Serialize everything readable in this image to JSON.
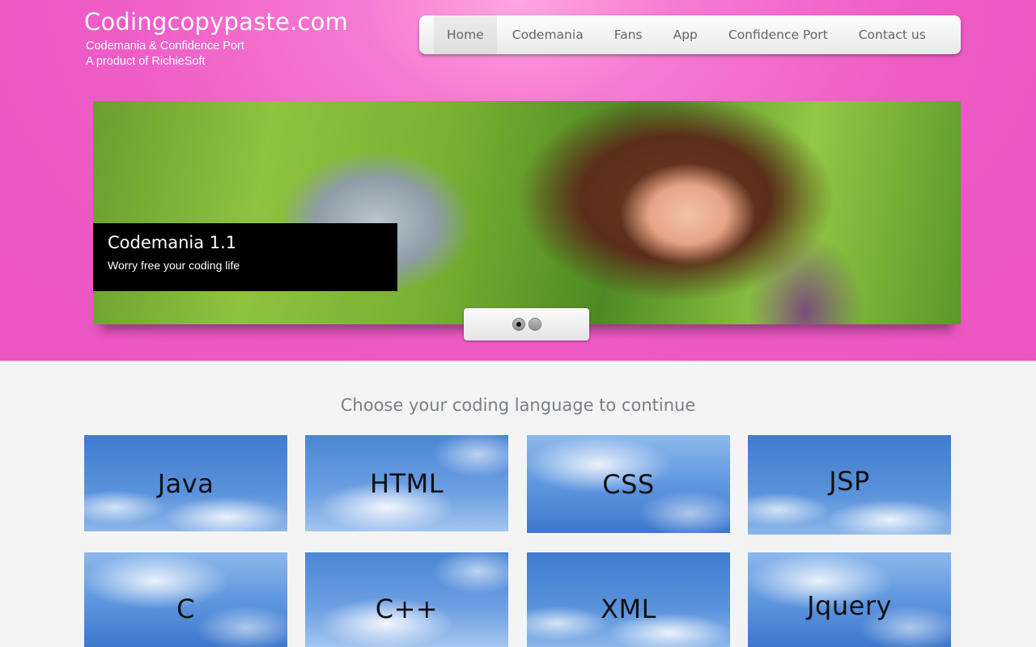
{
  "brand": {
    "title": "Codingcopypaste.com",
    "subtitle_line1": "Codemania & Confidence Port",
    "subtitle_line2": "A product of RichieSoft"
  },
  "nav": {
    "items": [
      {
        "label": "Home",
        "active": true
      },
      {
        "label": "Codemania",
        "active": false
      },
      {
        "label": "Fans",
        "active": false
      },
      {
        "label": "App",
        "active": false
      },
      {
        "label": "Confidence Port",
        "active": false
      },
      {
        "label": "Contact us",
        "active": false
      }
    ]
  },
  "slider": {
    "caption_title": "Codemania 1.1",
    "caption_text": "Worry free your coding life",
    "slide_count": 2,
    "active_slide": 1
  },
  "main": {
    "section_title": "Choose your coding language to continue",
    "tiles": [
      {
        "label": "Java"
      },
      {
        "label": "HTML"
      },
      {
        "label": "CSS"
      },
      {
        "label": "JSP"
      },
      {
        "label": "C"
      },
      {
        "label": "C++"
      },
      {
        "label": "XML"
      },
      {
        "label": "Jquery"
      }
    ]
  },
  "colors": {
    "header_pink": "#eb55c2",
    "caption_bg": "#000000",
    "tile_blue": "#3f7ccf"
  }
}
